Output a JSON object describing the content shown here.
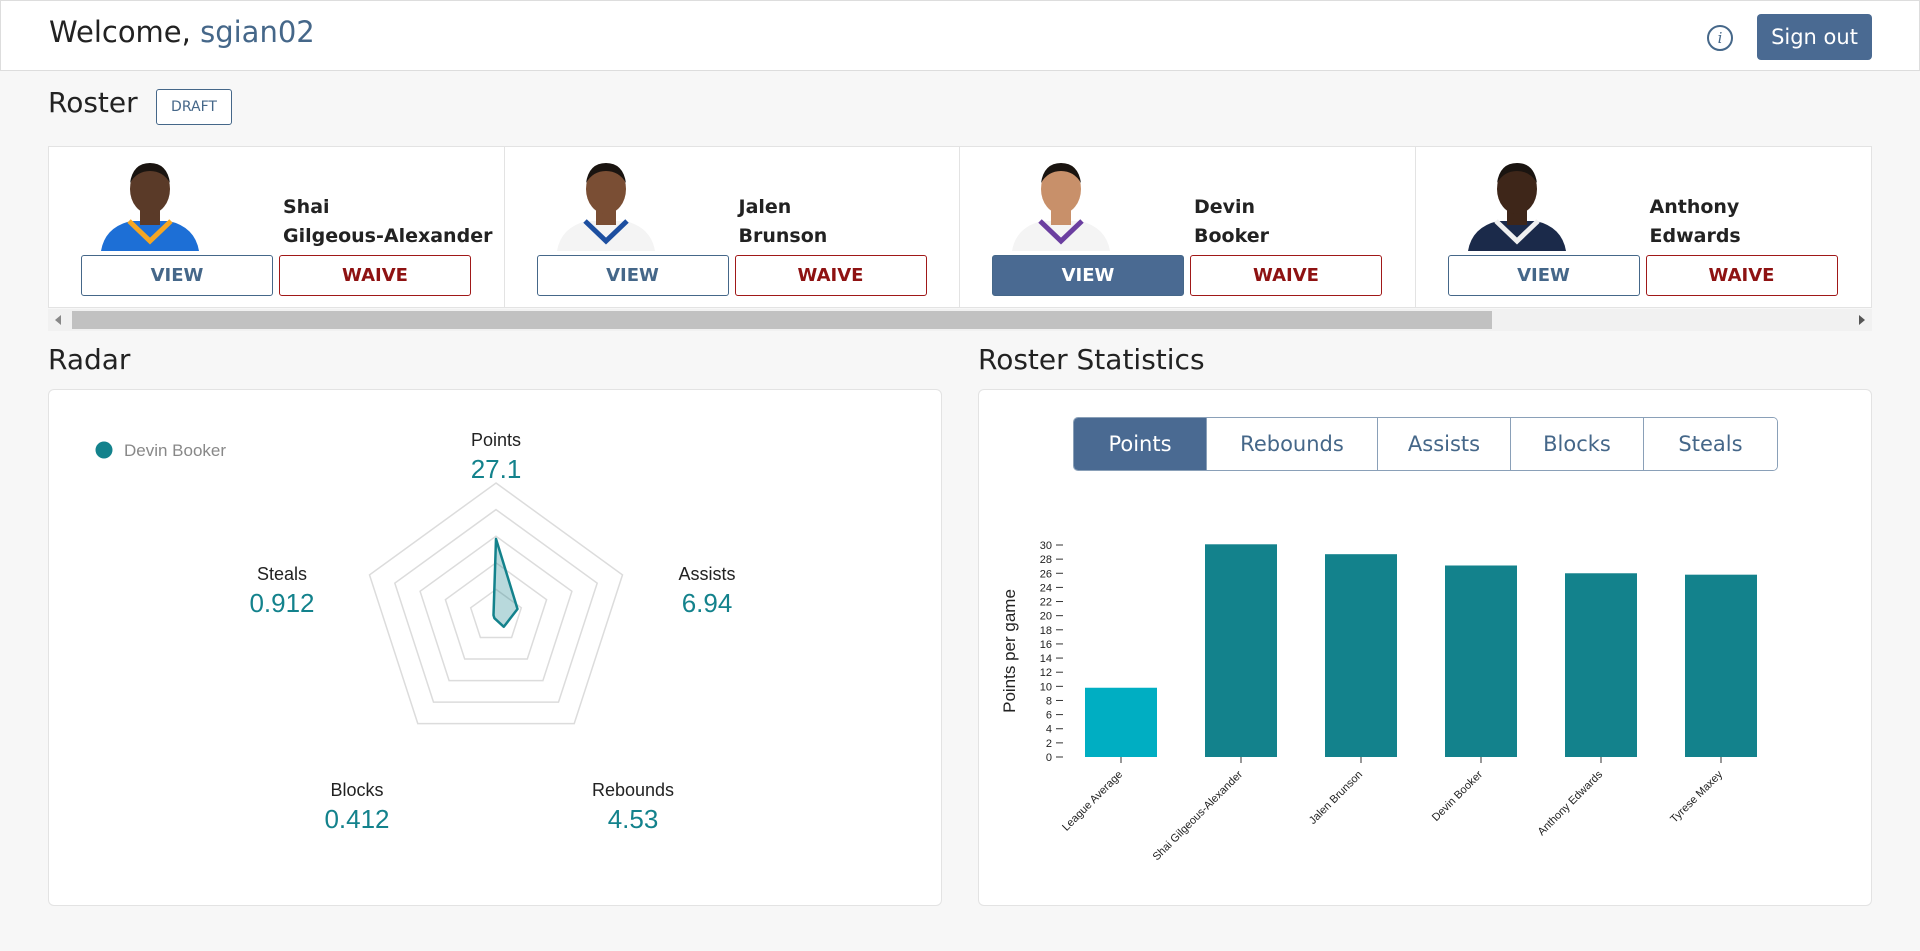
{
  "header": {
    "welcome_prefix": "Welcome,",
    "username": "sgian02",
    "info_glyph": "i",
    "signout_label": "Sign out"
  },
  "roster": {
    "title": "Roster",
    "draft_label": "DRAFT",
    "players": [
      {
        "first": "Shai",
        "last": "Gilgeous-Alexander",
        "view_label": "VIEW",
        "waive_label": "WAIVE",
        "jersey": "#1d6fd6",
        "trim": "#f5a623",
        "skin": "#5a3a28",
        "selected": false
      },
      {
        "first": "Jalen",
        "last": "Brunson",
        "view_label": "VIEW",
        "waive_label": "WAIVE",
        "jersey": "#f4f4f4",
        "trim": "#1d4fa0",
        "skin": "#7a4e34",
        "selected": false
      },
      {
        "first": "Devin",
        "last": "Booker",
        "view_label": "VIEW",
        "waive_label": "WAIVE",
        "jersey": "#f4f4f4",
        "trim": "#6b3fa0",
        "skin": "#c8906a",
        "selected": true
      },
      {
        "first": "Anthony",
        "last": "Edwards",
        "view_label": "VIEW",
        "waive_label": "WAIVE",
        "jersey": "#1b2a4a",
        "trim": "#f0f0f0",
        "skin": "#3e2619",
        "selected": false
      }
    ]
  },
  "radar": {
    "title": "Radar",
    "legend": "Devin Booker",
    "color": "#13828c",
    "axes": [
      {
        "label": "Points",
        "value": "27.1",
        "fraction": 0.58
      },
      {
        "label": "Assists",
        "value": "6.94",
        "fraction": 0.17
      },
      {
        "label": "Rebounds",
        "value": "4.53",
        "fraction": 0.1
      },
      {
        "label": "Blocks",
        "value": "0.412",
        "fraction": 0.02
      },
      {
        "label": "Steals",
        "value": "0.912",
        "fraction": 0.02
      }
    ]
  },
  "stats": {
    "title": "Roster Statistics",
    "tabs": [
      "Points",
      "Rebounds",
      "Assists",
      "Blocks",
      "Steals"
    ],
    "active_tab": "Points"
  },
  "chart_data": {
    "type": "bar",
    "ylabel": "Points per game",
    "ylim": [
      0,
      30
    ],
    "yticks": [
      0,
      2,
      4,
      6,
      8,
      10,
      12,
      14,
      16,
      18,
      20,
      22,
      24,
      26,
      28,
      30
    ],
    "categories": [
      "League Average",
      "Shai Gilgeous-Alexander",
      "Jalen Brunson",
      "Devin Booker",
      "Anthony Edwards",
      "Tyrese Maxey"
    ],
    "values": [
      9.8,
      30.1,
      28.7,
      27.1,
      26.0,
      25.8
    ],
    "colors": [
      "#00aec2",
      "#13828c",
      "#13828c",
      "#13828c",
      "#13828c",
      "#13828c"
    ]
  }
}
